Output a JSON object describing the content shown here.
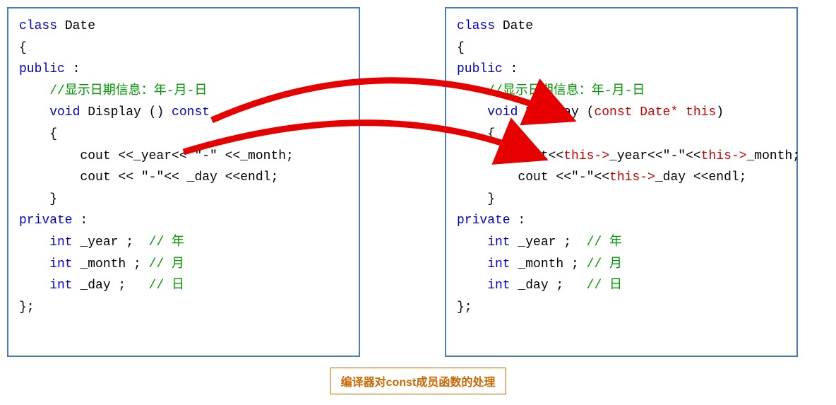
{
  "left": {
    "l1a": "class",
    "l1b": " Date",
    "l2": "{",
    "l3a": "public",
    "l3b": " :",
    "l4": "    //显示日期信息：年-月-日",
    "l5a": "    void",
    "l5b": " Display () ",
    "l5c": "const",
    "l6": "    {",
    "l7": "        cout <<_year<< \"-\" <<_month;",
    "l8": "        cout << \"-\"<< _day <<endl;",
    "l9": "    }",
    "l10a": "private",
    "l10b": " :",
    "l11a": "    int",
    "l11b": " _year ;  ",
    "l11c": "// 年",
    "l12a": "    int",
    "l12b": " _month ; ",
    "l12c": "// 月",
    "l13a": "    int",
    "l13b": " _day ;   ",
    "l13c": "// 日",
    "l14": "};"
  },
  "right": {
    "l1a": "class",
    "l1b": " Date",
    "l2": "{",
    "l3a": "public",
    "l3b": " :",
    "l4": "    //显示日期信息：年-月-日",
    "l5a": "    void",
    "l5b": " Display (",
    "l5c": "const Date* this",
    "l5d": ")",
    "l6": "    {",
    "l7a": "        cout<<",
    "l7b": "this->",
    "l7c": "_year<<\"-\"<<",
    "l7d": "this->",
    "l7e": "_month;",
    "l8a": "        cout <<\"-\"<<",
    "l8b": "this->",
    "l8c": "_day <<endl;",
    "l9": "    }",
    "l10a": "private",
    "l10b": " :",
    "l11a": "    int",
    "l11b": " _year ;  ",
    "l11c": "// 年",
    "l12a": "    int",
    "l12b": " _month ; ",
    "l12c": "// 月",
    "l13a": "    int",
    "l13b": " _day ;   ",
    "l13c": "// 日",
    "l14": "};"
  },
  "caption": "编译器对const成员函数的处理"
}
